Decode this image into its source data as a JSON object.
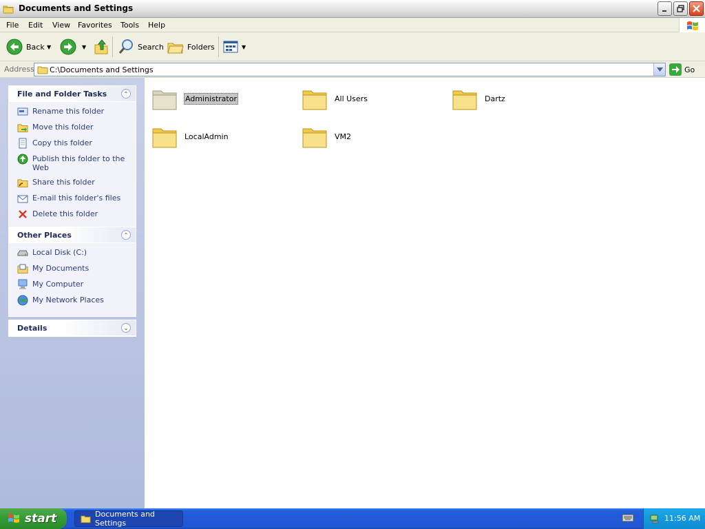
{
  "window": {
    "title": "Documents and Settings"
  },
  "menu": [
    "File",
    "Edit",
    "View",
    "Favorites",
    "Tools",
    "Help"
  ],
  "toolbar": {
    "back": "Back",
    "search": "Search",
    "folders": "Folders"
  },
  "address": {
    "label": "Address",
    "value": "C:\\Documents and Settings",
    "go": "Go"
  },
  "tasks_panel": {
    "title": "File and Folder Tasks",
    "items": [
      {
        "label": "Rename this folder",
        "icon": "rename-icon"
      },
      {
        "label": "Move this folder",
        "icon": "move-icon"
      },
      {
        "label": "Copy this folder",
        "icon": "copy-icon"
      },
      {
        "label": "Publish this folder to the Web",
        "icon": "publish-web-icon"
      },
      {
        "label": "Share this folder",
        "icon": "share-icon"
      },
      {
        "label": "E-mail this folder's files",
        "icon": "email-icon"
      },
      {
        "label": "Delete this folder",
        "icon": "delete-icon"
      }
    ]
  },
  "other_places": {
    "title": "Other Places",
    "items": [
      {
        "label": "Local Disk (C:)",
        "icon": "local-disk-icon"
      },
      {
        "label": "My Documents",
        "icon": "my-documents-icon"
      },
      {
        "label": "My Computer",
        "icon": "my-computer-icon"
      },
      {
        "label": "My Network Places",
        "icon": "network-places-icon"
      }
    ]
  },
  "details": {
    "title": "Details"
  },
  "folders": [
    {
      "label": "Administrator",
      "selected": true
    },
    {
      "label": "All Users"
    },
    {
      "label": "Dartz"
    },
    {
      "label": "LocalAdmin"
    },
    {
      "label": "VM2"
    }
  ],
  "taskbar": {
    "start": "start",
    "window": "Documents and Settings",
    "clock": "11:56 AM"
  },
  "colors": {
    "taskbar_blue": "#245edc",
    "start_green": "#379d37",
    "task_link": "#2a3b7a",
    "folder_yellow": "#f5d76e"
  }
}
